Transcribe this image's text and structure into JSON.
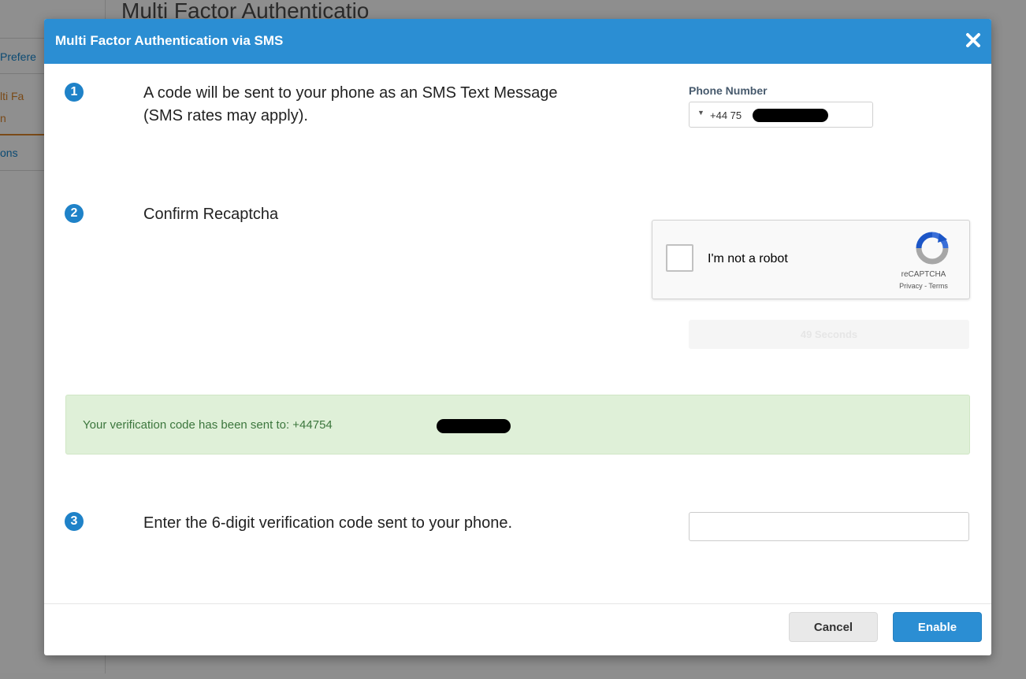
{
  "background": {
    "page_title": "Multi Factor Authenticatio",
    "sidebar": {
      "item1": "Prefere",
      "item2_line1": "lti Fa",
      "item2_line2": "n",
      "item3": "ons"
    }
  },
  "modal": {
    "title": "Multi Factor Authentication via SMS",
    "close_icon": "close-icon",
    "steps": [
      {
        "number": "1",
        "text_line1": "A code will be sent to your phone as an SMS Text Message",
        "text_line2": "(SMS rates may apply)."
      },
      {
        "number": "2",
        "text": "Confirm Recaptcha"
      },
      {
        "number": "3",
        "text": "Enter the 6-digit verification code sent to your phone."
      }
    ],
    "phone": {
      "label": "Phone Number",
      "value": "+44 75"
    },
    "recaptcha": {
      "label": "I'm not a robot",
      "brand": "reCAPTCHA",
      "links": "Privacy - Terms"
    },
    "timer_label": "49 Seconds",
    "alert_message": "Your verification code has been sent to: +44754",
    "code_input_value": "",
    "buttons": {
      "cancel": "Cancel",
      "enable": "Enable"
    }
  },
  "colors": {
    "header": "#2b8ed3",
    "step_badge": "#1f82c8",
    "alert_bg": "#dff0d8",
    "alert_text": "#3c763d"
  }
}
